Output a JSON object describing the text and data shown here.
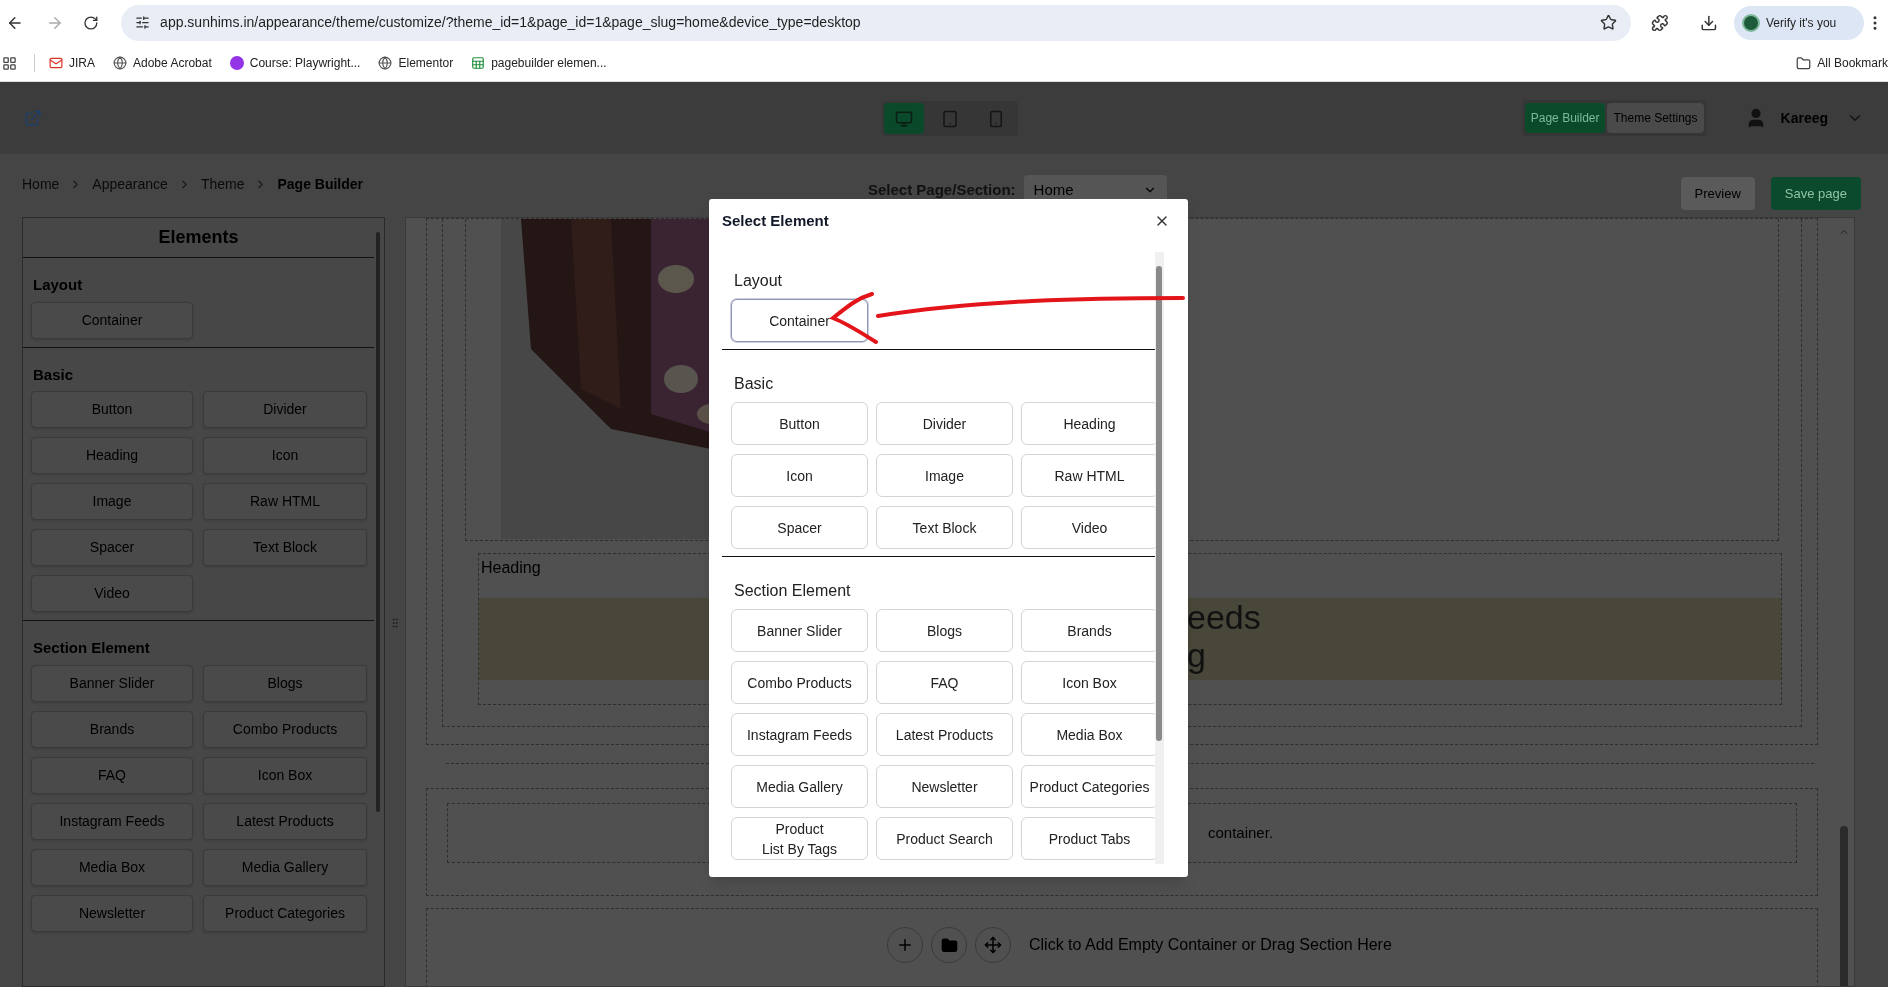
{
  "browser": {
    "url": "app.sunhims.in/appearance/theme/customize/?theme_id=1&page_id=1&page_slug=home&device_type=desktop",
    "profile_button": "Verify it's you",
    "all_bookmarks": "All Bookmark",
    "bookmarks": [
      {
        "label": "JIRA",
        "kind": "mail"
      },
      {
        "label": "Adobe Acrobat",
        "kind": "globe"
      },
      {
        "label": "Course: Playwright...",
        "kind": "badge"
      },
      {
        "label": "Elementor",
        "kind": "globe"
      },
      {
        "label": "pagebuilder elemen...",
        "kind": "sheet"
      }
    ]
  },
  "header": {
    "devices": [
      {
        "kind": "desktop",
        "selected": true
      },
      {
        "kind": "tablet",
        "selected": false
      },
      {
        "kind": "mobile",
        "selected": false
      }
    ],
    "modes": [
      {
        "label": "Page Builder",
        "selected": true
      },
      {
        "label": "Theme Settings",
        "selected": false
      }
    ],
    "user": "Kareeg"
  },
  "breadcrumbs": [
    "Home",
    "Appearance",
    "Theme",
    "Page Builder"
  ],
  "page_select": {
    "label": "Select Page/Section:",
    "value": "Home"
  },
  "actions": [
    {
      "label": "Preview",
      "kind": "secondary"
    },
    {
      "label": "Save page",
      "kind": "primary"
    }
  ],
  "sidebar": {
    "title": "Elements",
    "sections": [
      {
        "title": "Layout",
        "items": [
          "Container"
        ]
      },
      {
        "title": "Basic",
        "items": [
          "Button",
          "Divider",
          "Heading",
          "Icon",
          "Image",
          "Raw HTML",
          "Spacer",
          "Text Block",
          "Video"
        ]
      },
      {
        "title": "Section Element",
        "items": [
          "Banner Slider",
          "Blogs",
          "Brands",
          "Combo Products",
          "FAQ",
          "Icon Box",
          "Instagram Feeds",
          "Latest Products",
          "Media Box",
          "Media Gallery",
          "Newsletter",
          "Product Categories"
        ]
      }
    ]
  },
  "canvas": {
    "heading": "Heading",
    "banner_lines": [
      "eeds",
      "g"
    ],
    "container_note": "container.",
    "add_prompt": "Click to Add Empty Container or Drag Section Here"
  },
  "modal": {
    "title": "Select Element",
    "sections": [
      {
        "title": "Layout",
        "items": [
          {
            "label": "Container",
            "focused": true
          }
        ]
      },
      {
        "title": "Basic",
        "items": [
          {
            "label": "Button",
            "focused": false
          },
          {
            "label": "Divider",
            "focused": false
          },
          {
            "label": "Heading",
            "focused": false
          },
          {
            "label": "Icon",
            "focused": false
          },
          {
            "label": "Image",
            "focused": false
          },
          {
            "label": "Raw HTML",
            "focused": false
          },
          {
            "label": "Spacer",
            "focused": false
          },
          {
            "label": "Text Block",
            "focused": false
          },
          {
            "label": "Video",
            "focused": false
          }
        ]
      },
      {
        "title": "Section Element",
        "items": [
          {
            "label": "Banner Slider",
            "focused": false
          },
          {
            "label": "Blogs",
            "focused": false
          },
          {
            "label": "Brands",
            "focused": false
          },
          {
            "label": "Combo Products",
            "focused": false
          },
          {
            "label": "FAQ",
            "focused": false
          },
          {
            "label": "Icon Box",
            "focused": false
          },
          {
            "label": "Instagram Feeds",
            "focused": false
          },
          {
            "label": "Latest Products",
            "focused": false
          },
          {
            "label": "Media Box",
            "focused": false
          },
          {
            "label": "Media Gallery",
            "focused": false
          },
          {
            "label": "Newsletter",
            "focused": false
          },
          {
            "label": "Product Categories",
            "focused": false
          },
          {
            "label": "Product\nList By Tags",
            "focused": false
          },
          {
            "label": "Product Search",
            "focused": false
          },
          {
            "label": "Product Tabs",
            "focused": false
          }
        ]
      }
    ]
  }
}
